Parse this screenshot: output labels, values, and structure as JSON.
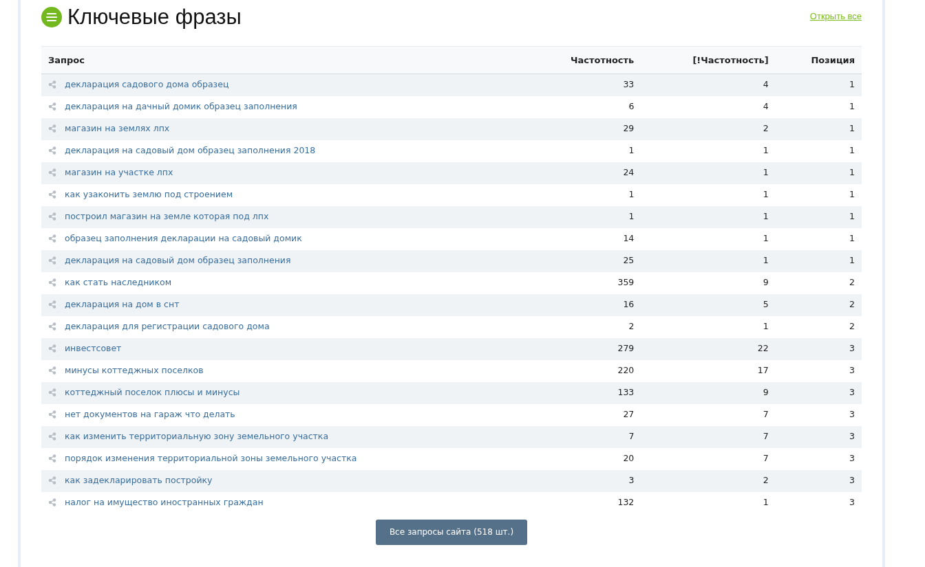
{
  "title": "Ключевые фразы",
  "open_all_link": "Открыть все",
  "table": {
    "columns": [
      "Запрос",
      "Частотность",
      "[!Частотность]",
      "Позиция"
    ],
    "rows": [
      [
        "декларация садового дома образец",
        "33",
        "4",
        "1"
      ],
      [
        "декларация на дачный домик образец заполнения",
        "6",
        "4",
        "1"
      ],
      [
        "магазин на землях лпх",
        "29",
        "2",
        "1"
      ],
      [
        "декларация на садовый дом образец заполнения 2018",
        "1",
        "1",
        "1"
      ],
      [
        "магазин на участке лпх",
        "24",
        "1",
        "1"
      ],
      [
        "как узаконить землю под строением",
        "1",
        "1",
        "1"
      ],
      [
        "построил магазин на земле которая под лпх",
        "1",
        "1",
        "1"
      ],
      [
        "образец заполнения декларации на садовый домик",
        "14",
        "1",
        "1"
      ],
      [
        "декларация на садовый дом образец заполнения",
        "25",
        "1",
        "1"
      ],
      [
        "как стать наследником",
        "359",
        "9",
        "2"
      ],
      [
        "декларация на дом в снт",
        "16",
        "5",
        "2"
      ],
      [
        "декларация для регистрации садового дома",
        "2",
        "1",
        "2"
      ],
      [
        "инвестсовет",
        "279",
        "22",
        "3"
      ],
      [
        "минусы коттеджных поселков",
        "220",
        "17",
        "3"
      ],
      [
        "коттеджный поселок плюсы и минусы",
        "133",
        "9",
        "3"
      ],
      [
        "нет документов на гараж что делать",
        "27",
        "7",
        "3"
      ],
      [
        "как изменить территориальную зону земельного участка",
        "7",
        "7",
        "3"
      ],
      [
        "порядок изменения территориальной зоны земельного участка",
        "20",
        "7",
        "3"
      ],
      [
        "как задекларировать постройку",
        "3",
        "2",
        "3"
      ],
      [
        "налог на имущество иностранных граждан",
        "132",
        "1",
        "3"
      ]
    ]
  },
  "all_queries_button": "Все запросы сайта (518 шт.)"
}
